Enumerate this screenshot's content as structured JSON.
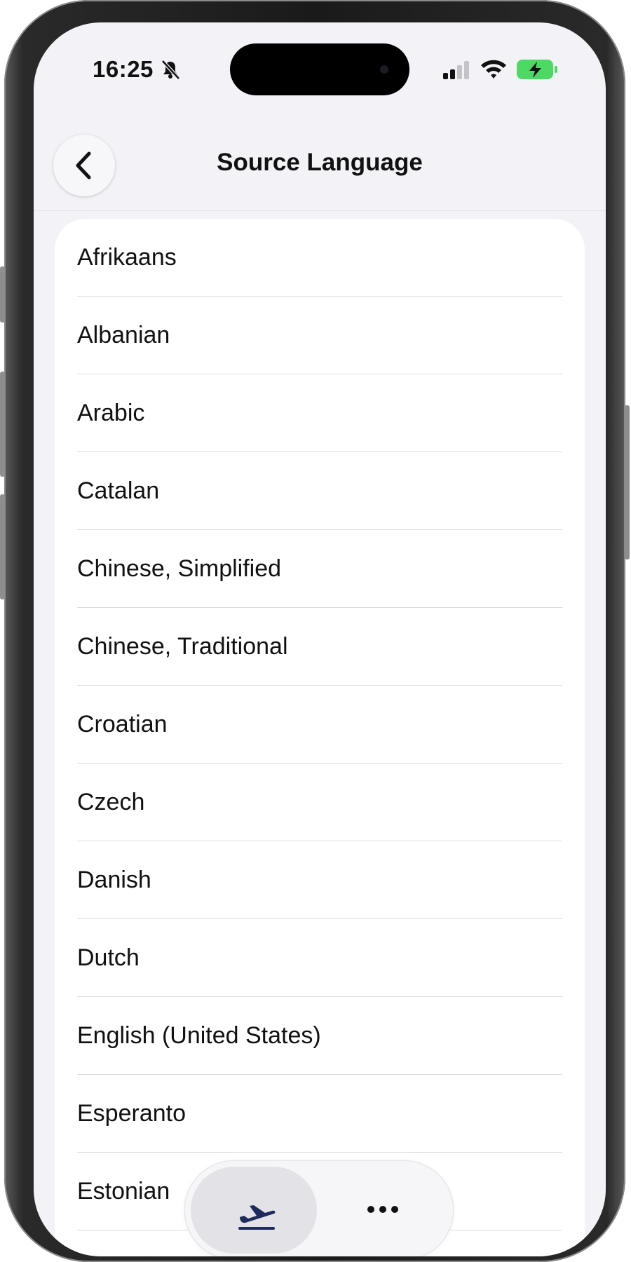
{
  "status_bar": {
    "time": "16:25"
  },
  "nav": {
    "title": "Source Language"
  },
  "languages": [
    {
      "label": "Afrikaans"
    },
    {
      "label": "Albanian"
    },
    {
      "label": "Arabic"
    },
    {
      "label": "Catalan"
    },
    {
      "label": "Chinese, Simplified"
    },
    {
      "label": "Chinese, Traditional"
    },
    {
      "label": "Croatian"
    },
    {
      "label": "Czech"
    },
    {
      "label": "Danish"
    },
    {
      "label": "Dutch"
    },
    {
      "label": "English (United States)"
    },
    {
      "label": "Esperanto"
    },
    {
      "label": "Estonian"
    }
  ],
  "icons": {
    "back": "chevron-left-icon",
    "mute": "bell-slash-icon",
    "signal": "cellular-signal-icon",
    "wifi": "wifi-icon",
    "battery": "battery-charging-icon",
    "tab_active": "airplane-takeoff-icon",
    "tab_more": "more-icon"
  },
  "colors": {
    "battery": "#4cd964",
    "active_tab_icon": "#1f2a5c",
    "background": "#f2f2f7"
  }
}
